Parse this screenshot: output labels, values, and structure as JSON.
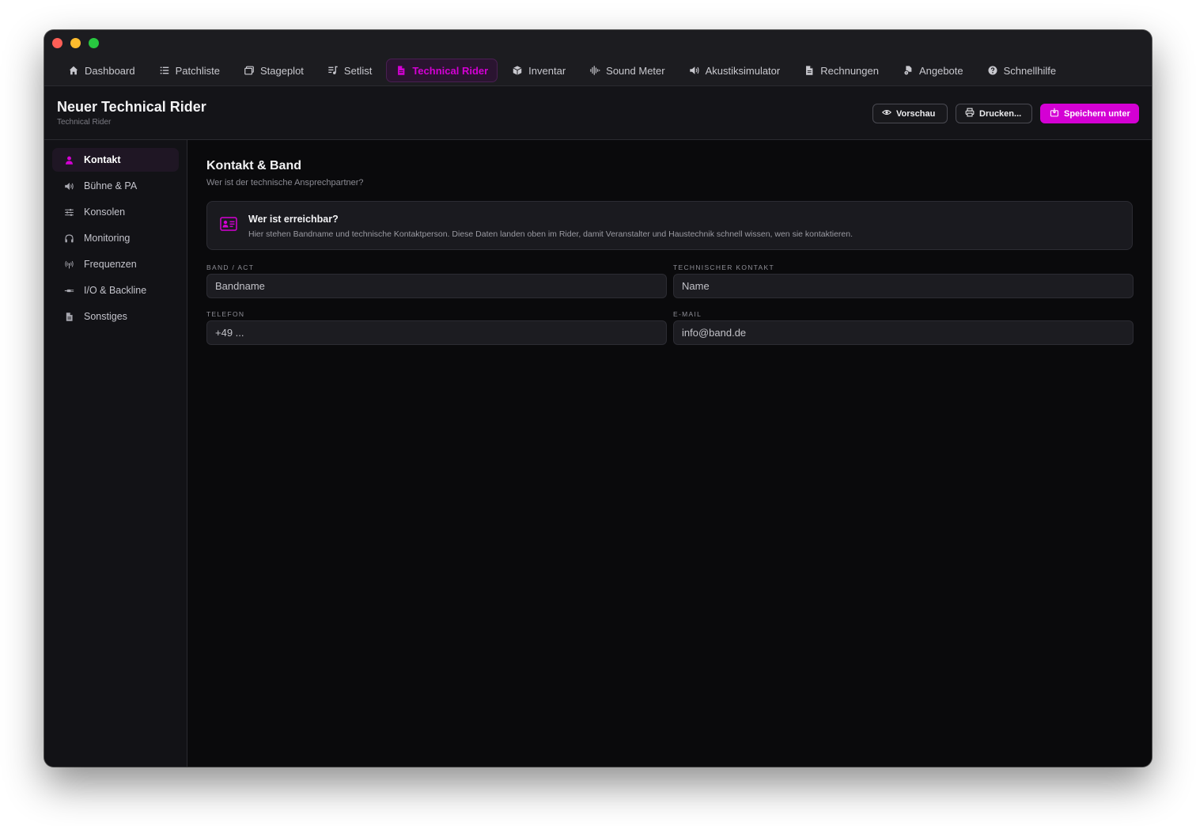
{
  "colors": {
    "accent": "#d400d4",
    "window_bg": "#0a0a0c",
    "nav_bg": "#1c1c20",
    "sidebar_bg": "#121216"
  },
  "nav": {
    "items": [
      {
        "label": "Dashboard",
        "icon": "home-icon"
      },
      {
        "label": "Patchliste",
        "icon": "list-icon"
      },
      {
        "label": "Stageplot",
        "icon": "stage-icon"
      },
      {
        "label": "Setlist",
        "icon": "music-list-icon"
      },
      {
        "label": "Technical Rider",
        "icon": "document-icon",
        "active": true
      },
      {
        "label": "Inventar",
        "icon": "box-icon"
      },
      {
        "label": "Sound Meter",
        "icon": "waveform-icon"
      },
      {
        "label": "Akustiksimulator",
        "icon": "speaker-icon"
      },
      {
        "label": "Rechnungen",
        "icon": "invoice-icon"
      },
      {
        "label": "Angebote",
        "icon": "offer-icon"
      },
      {
        "label": "Schnellhilfe",
        "icon": "help-icon"
      }
    ]
  },
  "header": {
    "title": "Neuer Technical Rider",
    "subtitle": "Technical Rider",
    "preview_label": "Vorschau",
    "print_label": "Drucken...",
    "save_label": "Speichern unter"
  },
  "sidebar": {
    "items": [
      {
        "label": "Kontakt",
        "icon": "person-icon",
        "active": true
      },
      {
        "label": "Bühne & PA",
        "icon": "speaker-icon"
      },
      {
        "label": "Konsolen",
        "icon": "sliders-icon"
      },
      {
        "label": "Monitoring",
        "icon": "headphones-icon"
      },
      {
        "label": "Frequenzen",
        "icon": "antenna-icon"
      },
      {
        "label": "I/O & Backline",
        "icon": "cable-icon"
      },
      {
        "label": "Sonstiges",
        "icon": "document-icon"
      }
    ]
  },
  "main": {
    "title": "Kontakt & Band",
    "subtitle": "Wer ist der technische Ansprechpartner?",
    "info": {
      "title": "Wer ist erreichbar?",
      "text": "Hier stehen Bandname und technische Kontaktperson. Diese Daten landen oben im Rider, damit Veranstalter und Haustechnik schnell wissen, wen sie kontaktieren."
    },
    "fields": {
      "band": {
        "label": "BAND / ACT",
        "placeholder": "Bandname"
      },
      "contact": {
        "label": "TECHNISCHER KONTAKT",
        "placeholder": "Name"
      },
      "phone": {
        "label": "TELEFON",
        "placeholder": "+49 ..."
      },
      "email": {
        "label": "E-MAIL",
        "placeholder": "info@band.de"
      }
    }
  }
}
